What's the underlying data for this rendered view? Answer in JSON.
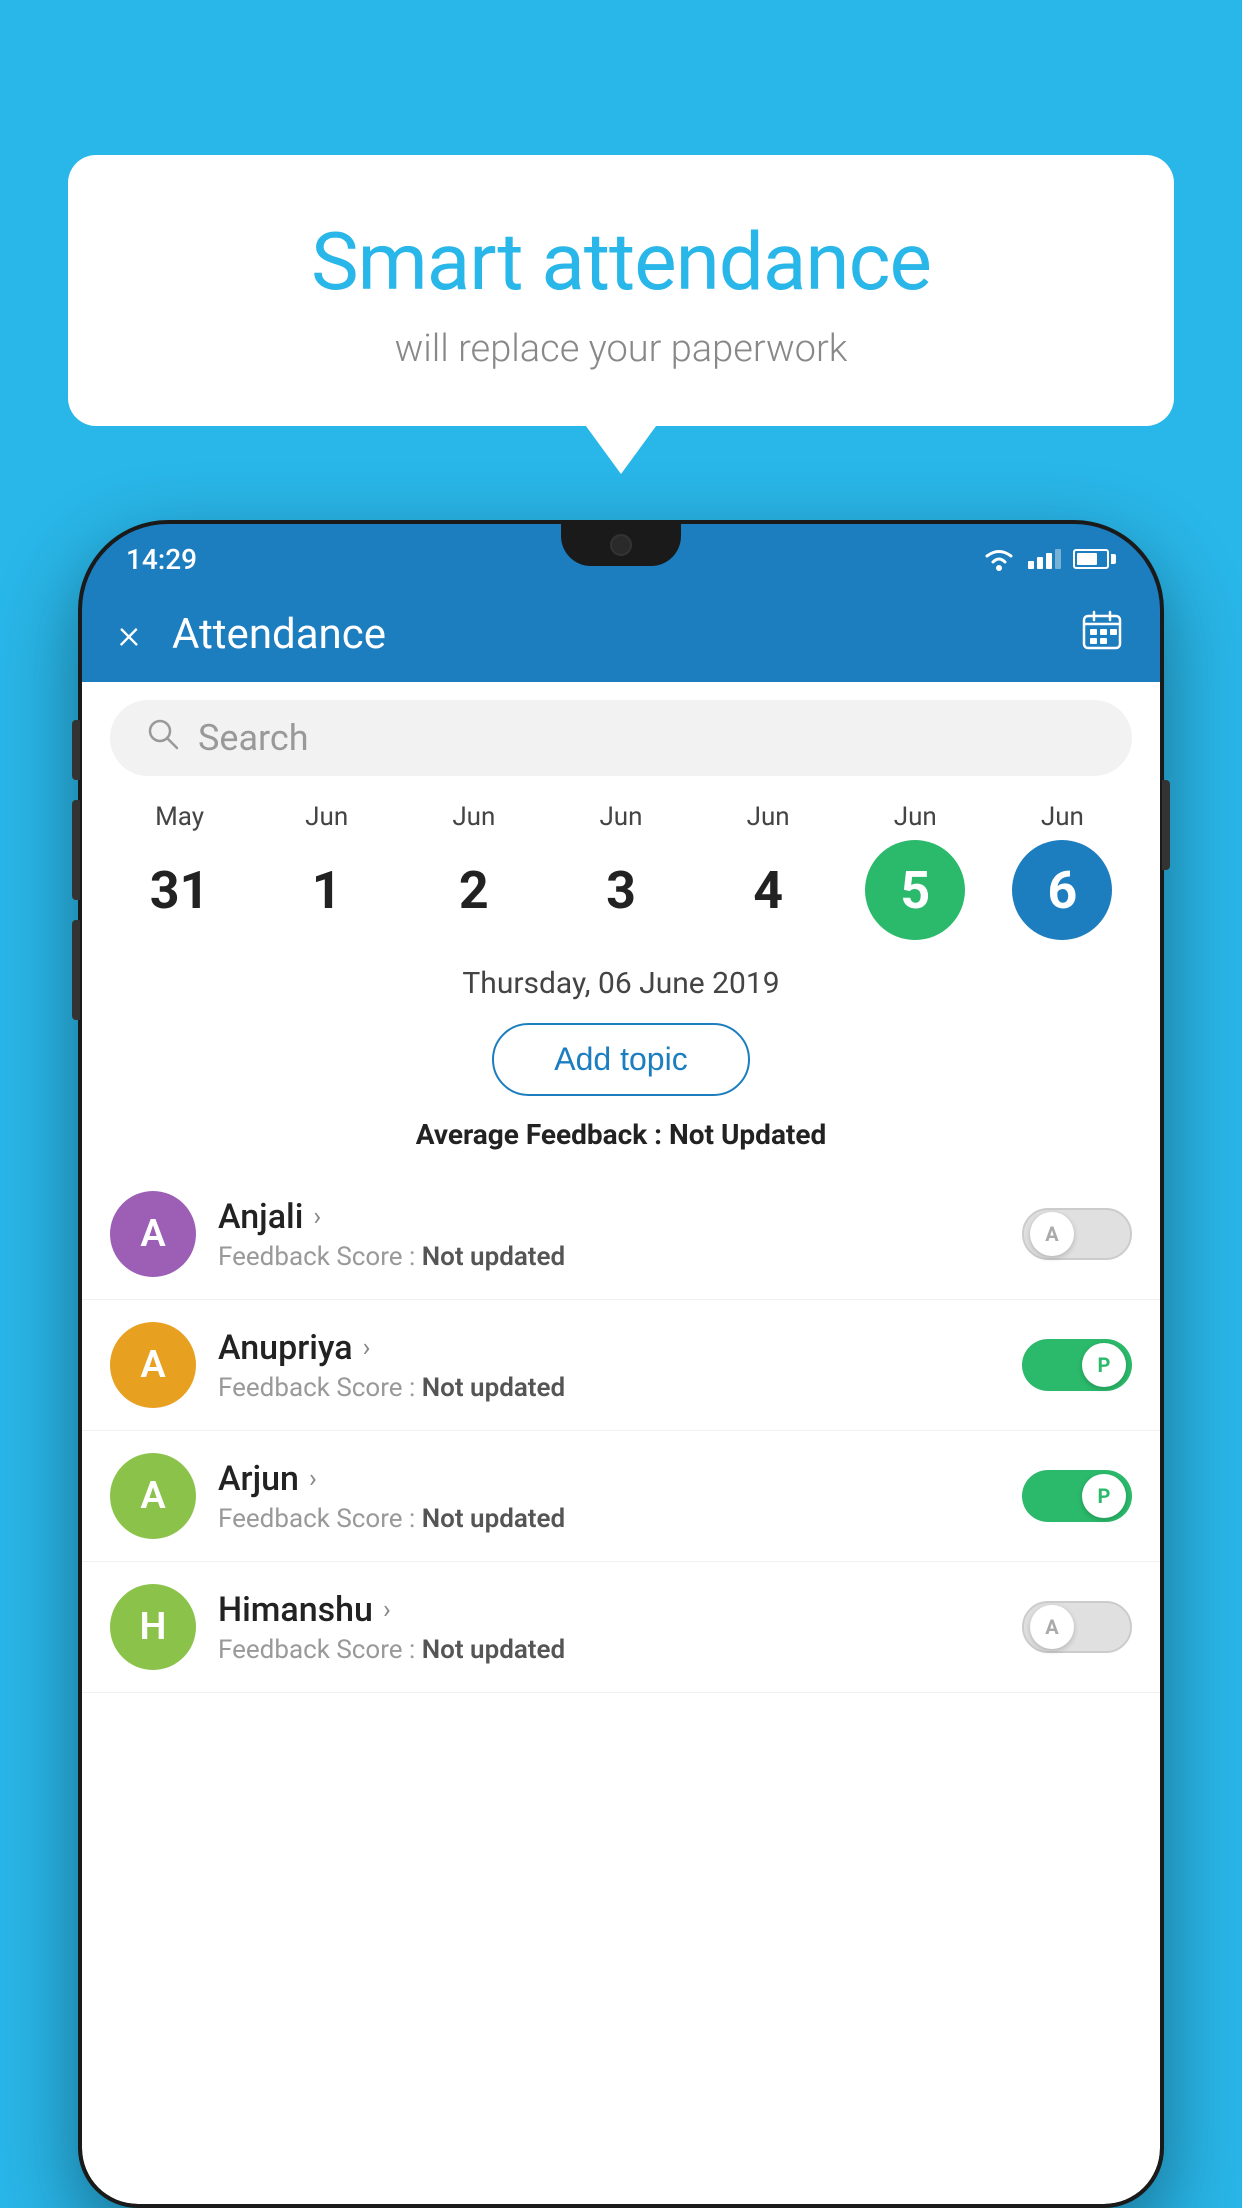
{
  "background_color": "#29b6e8",
  "speech_bubble": {
    "title": "Smart attendance",
    "subtitle": "will replace your paperwork"
  },
  "status_bar": {
    "time": "14:29",
    "icons": [
      "wifi",
      "signal",
      "battery"
    ]
  },
  "app_bar": {
    "close_label": "×",
    "title": "Attendance",
    "calendar_icon": "📅"
  },
  "search": {
    "placeholder": "Search"
  },
  "dates": [
    {
      "month": "May",
      "day": "31",
      "style": "normal"
    },
    {
      "month": "Jun",
      "day": "1",
      "style": "normal"
    },
    {
      "month": "Jun",
      "day": "2",
      "style": "normal"
    },
    {
      "month": "Jun",
      "day": "3",
      "style": "normal"
    },
    {
      "month": "Jun",
      "day": "4",
      "style": "normal"
    },
    {
      "month": "Jun",
      "day": "5",
      "style": "today"
    },
    {
      "month": "Jun",
      "day": "6",
      "style": "selected"
    }
  ],
  "selected_date": "Thursday, 06 June 2019",
  "add_topic_label": "Add topic",
  "avg_feedback_label": "Average Feedback :",
  "avg_feedback_value": "Not Updated",
  "students": [
    {
      "name": "Anjali",
      "avatar_letter": "A",
      "avatar_color": "#9c5fb5",
      "feedback_label": "Feedback Score :",
      "feedback_value": "Not updated",
      "attendance": "absent",
      "toggle_letter": "A"
    },
    {
      "name": "Anupriya",
      "avatar_letter": "A",
      "avatar_color": "#e8a020",
      "feedback_label": "Feedback Score :",
      "feedback_value": "Not updated",
      "attendance": "present",
      "toggle_letter": "P"
    },
    {
      "name": "Arjun",
      "avatar_letter": "A",
      "avatar_color": "#8bc34a",
      "feedback_label": "Feedback Score :",
      "feedback_value": "Not updated",
      "attendance": "present",
      "toggle_letter": "P"
    },
    {
      "name": "Himanshu",
      "avatar_letter": "H",
      "avatar_color": "#8bc34a",
      "feedback_label": "Feedback Score :",
      "feedback_value": "Not updated",
      "attendance": "absent",
      "toggle_letter": "A"
    }
  ]
}
